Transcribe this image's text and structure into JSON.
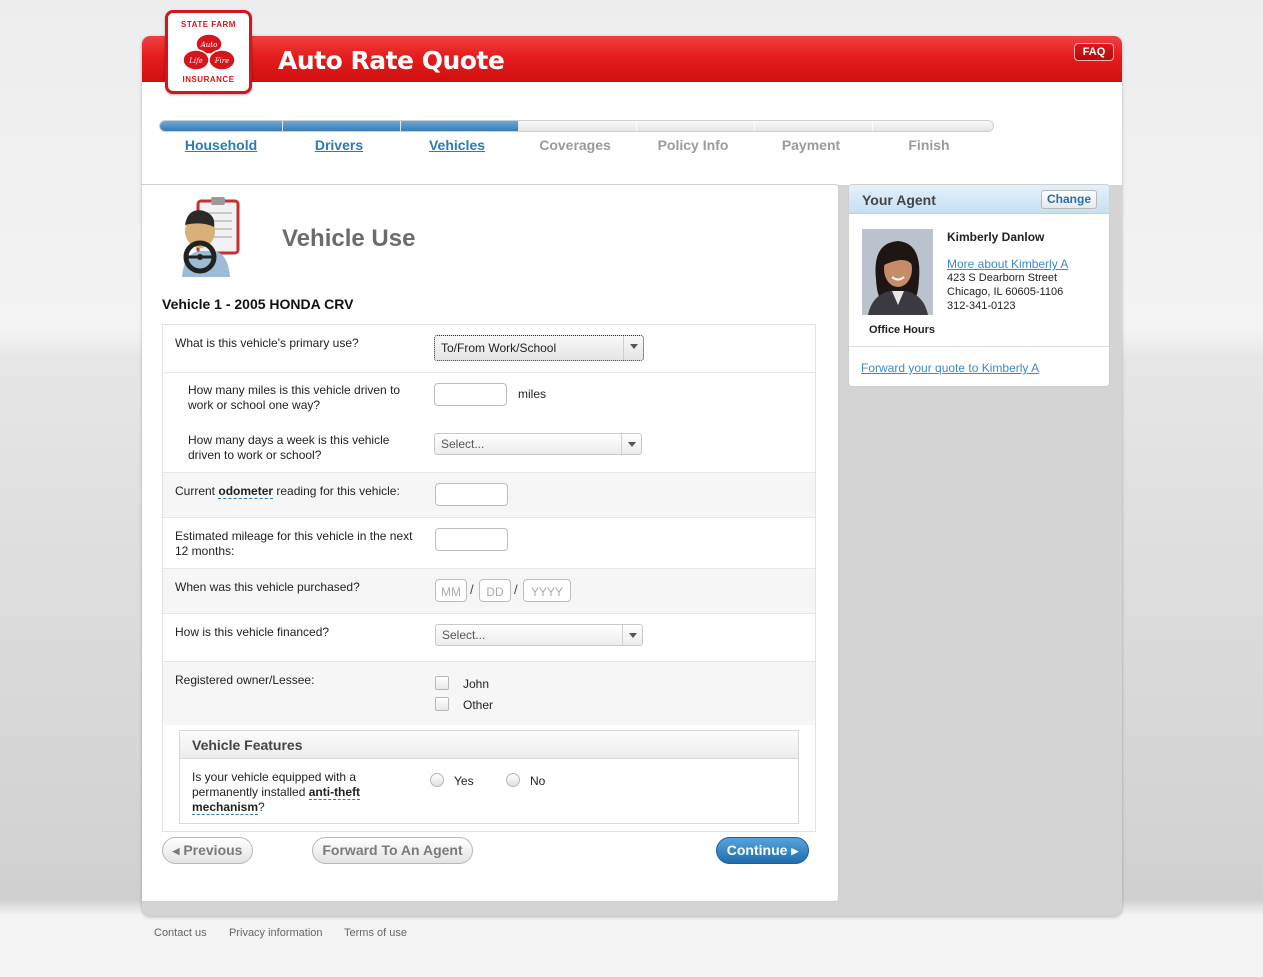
{
  "app": {
    "title": "Auto Rate Quote",
    "faq_label": "FAQ",
    "logo": {
      "line1": "STATE FARM",
      "line2": "INSURANCE",
      "auto": "Auto",
      "life": "Life",
      "fire": "Fire"
    }
  },
  "progress": {
    "completed_fraction": 0.43,
    "steps": [
      {
        "label": "Household",
        "state": "done"
      },
      {
        "label": "Drivers",
        "state": "done"
      },
      {
        "label": "Vehicles",
        "state": "current"
      },
      {
        "label": "Coverages",
        "state": "todo"
      },
      {
        "label": "Policy Info",
        "state": "todo"
      },
      {
        "label": "Payment",
        "state": "todo"
      },
      {
        "label": "Finish",
        "state": "todo"
      }
    ]
  },
  "page": {
    "title": "Vehicle Use",
    "vehicle_label": "Vehicle 1 - 2005 HONDA CRV"
  },
  "form": {
    "primary_use": {
      "question": "What is this vehicle's primary use?",
      "value": "To/From Work/School"
    },
    "miles_one_way": {
      "question": "How many miles is this vehicle driven to work or school one way?",
      "value": "",
      "unit": "miles"
    },
    "days_per_week": {
      "question": "How many days a week is this vehicle driven to work or school?",
      "value": "Select..."
    },
    "odometer": {
      "question_prefix": "Current ",
      "question_term": "odometer",
      "question_suffix": " reading for this vehicle:",
      "value": ""
    },
    "estimated_mileage": {
      "question": "Estimated mileage for this vehicle in the next 12 months:",
      "value": ""
    },
    "purchased": {
      "question": "When was this vehicle purchased?",
      "mm_placeholder": "MM",
      "dd_placeholder": "DD",
      "yyyy_placeholder": "YYYY",
      "separator": "/"
    },
    "financed": {
      "question": "How is this vehicle financed?",
      "value": "Select..."
    },
    "registered_owner": {
      "question": "Registered owner/Lessee:",
      "options": [
        "John",
        "Other"
      ]
    }
  },
  "features": {
    "heading": "Vehicle Features",
    "antitheft": {
      "question_prefix": "Is your vehicle equipped with a permanently installed ",
      "question_term": "anti-theft mechanism",
      "question_suffix": "?",
      "options": [
        "Yes",
        "No"
      ]
    }
  },
  "buttons": {
    "previous": "Previous",
    "forward_agent": "Forward To An Agent",
    "continue": "Continue"
  },
  "agent": {
    "heading": "Your Agent",
    "change_label": "Change",
    "name": "Kimberly Danlow",
    "more_link": "More about Kimberly A",
    "address1": "423 S Dearborn Street",
    "address2": "Chicago, IL 60605-1106",
    "phone": "312-341-0123",
    "office_hours": "Office Hours",
    "forward_link": "Forward your quote to Kimberly A"
  },
  "footer": {
    "links": [
      "Contact us",
      "Privacy information",
      "Terms of use"
    ]
  },
  "colors": {
    "brand_red": "#e51c1c",
    "link_blue": "#2a7bb8",
    "progress_blue": "#2e73b0"
  }
}
